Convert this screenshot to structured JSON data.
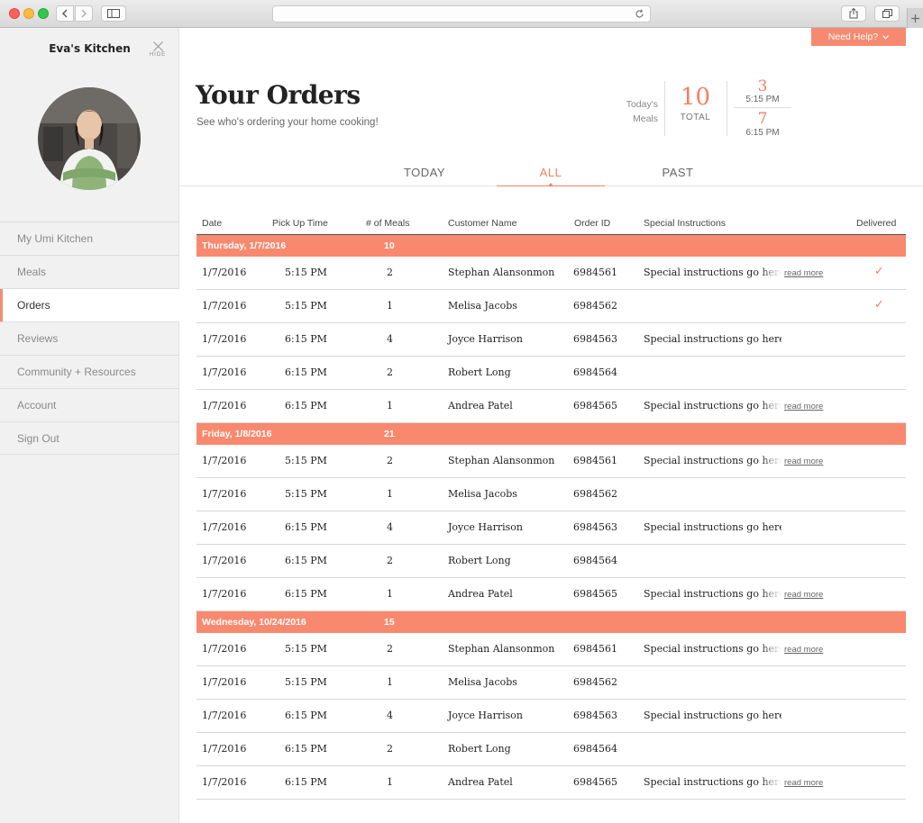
{
  "sidebar": {
    "kitchen_name": "Eva's Kitchen",
    "hide_label": "HIDE",
    "nav": [
      "My Umi Kitchen",
      "Meals",
      "Orders",
      "Reviews",
      "Community + Resources",
      "Account",
      "Sign Out"
    ],
    "active_nav": "Orders"
  },
  "header": {
    "help_label": "Need Help?",
    "title": "Your Orders",
    "subtitle": "See who's ordering your home cooking!",
    "today_label_1": "Today's",
    "today_label_2": "Meals",
    "total_num": "10",
    "total_label": "TOTAL",
    "slot1_num": "3",
    "slot1_time": "5:15 PM",
    "slot2_num": "7",
    "slot2_time": "6:15 PM"
  },
  "tabs": [
    "TODAY",
    "ALL",
    "PAST"
  ],
  "active_tab": "ALL",
  "table": {
    "columns": [
      "Date",
      "Pick Up Time",
      "# of Meals",
      "Customer Name",
      "Order ID",
      "Special Instructions",
      "Delivered"
    ],
    "read_more": "read more",
    "groups": [
      {
        "label": "Thursday, 1/7/2016",
        "total": "10",
        "rows": [
          {
            "date": "1/7/2016",
            "time": "5:15 PM",
            "meals": "2",
            "name": "Stephan Alansonmon",
            "oid": "6984561",
            "inst": "Special instructions go here. Th",
            "more": true,
            "delivered": true
          },
          {
            "date": "1/7/2016",
            "time": "5:15 PM",
            "meals": "1",
            "name": "Melisa Jacobs",
            "oid": "6984562",
            "inst": "",
            "more": false,
            "delivered": true
          },
          {
            "date": "1/7/2016",
            "time": "6:15 PM",
            "meals": "4",
            "name": "Joyce Harrison",
            "oid": "6984563",
            "inst": "Special instructions go here.",
            "more": false,
            "delivered": false
          },
          {
            "date": "1/7/2016",
            "time": "6:15 PM",
            "meals": "2",
            "name": "Robert Long",
            "oid": "6984564",
            "inst": "",
            "more": false,
            "delivered": false
          },
          {
            "date": "1/7/2016",
            "time": "6:15 PM",
            "meals": "1",
            "name": "Andrea Patel",
            "oid": "6984565",
            "inst": "Special instructions go here. Th",
            "more": true,
            "delivered": false
          }
        ]
      },
      {
        "label": "Friday, 1/8/2016",
        "total": "21",
        "rows": [
          {
            "date": "1/7/2016",
            "time": "5:15 PM",
            "meals": "2",
            "name": "Stephan Alansonmon",
            "oid": "6984561",
            "inst": "Special instructions go here. Th",
            "more": true,
            "delivered": false
          },
          {
            "date": "1/7/2016",
            "time": "5:15 PM",
            "meals": "1",
            "name": "Melisa Jacobs",
            "oid": "6984562",
            "inst": "",
            "more": false,
            "delivered": false
          },
          {
            "date": "1/7/2016",
            "time": "6:15 PM",
            "meals": "4",
            "name": "Joyce Harrison",
            "oid": "6984563",
            "inst": "Special instructions go here.",
            "more": false,
            "delivered": false
          },
          {
            "date": "1/7/2016",
            "time": "6:15 PM",
            "meals": "2",
            "name": "Robert Long",
            "oid": "6984564",
            "inst": "",
            "more": false,
            "delivered": false
          },
          {
            "date": "1/7/2016",
            "time": "6:15 PM",
            "meals": "1",
            "name": "Andrea Patel",
            "oid": "6984565",
            "inst": "Special instructions go here. Th",
            "more": true,
            "delivered": false
          }
        ]
      },
      {
        "label": "Wednesday, 10/24/2016",
        "total": "15",
        "rows": [
          {
            "date": "1/7/2016",
            "time": "5:15 PM",
            "meals": "2",
            "name": "Stephan Alansonmon",
            "oid": "6984561",
            "inst": "Special instructions go here. Th",
            "more": true,
            "delivered": false
          },
          {
            "date": "1/7/2016",
            "time": "5:15 PM",
            "meals": "1",
            "name": "Melisa Jacobs",
            "oid": "6984562",
            "inst": "",
            "more": false,
            "delivered": false
          },
          {
            "date": "1/7/2016",
            "time": "6:15 PM",
            "meals": "4",
            "name": "Joyce Harrison",
            "oid": "6984563",
            "inst": "Special instructions go here.",
            "more": false,
            "delivered": false
          },
          {
            "date": "1/7/2016",
            "time": "6:15 PM",
            "meals": "2",
            "name": "Robert Long",
            "oid": "6984564",
            "inst": "",
            "more": false,
            "delivered": false
          },
          {
            "date": "1/7/2016",
            "time": "6:15 PM",
            "meals": "1",
            "name": "Andrea Patel",
            "oid": "6984565",
            "inst": "Special instructions go here. Th",
            "more": true,
            "delivered": false
          }
        ]
      }
    ]
  },
  "colors": {
    "accent": "#f8896f",
    "accent_text": "#f47f63"
  },
  "icons": {
    "delivered": "checkmark-icon",
    "help": "chevron-down-icon",
    "hide": "close-icon"
  }
}
